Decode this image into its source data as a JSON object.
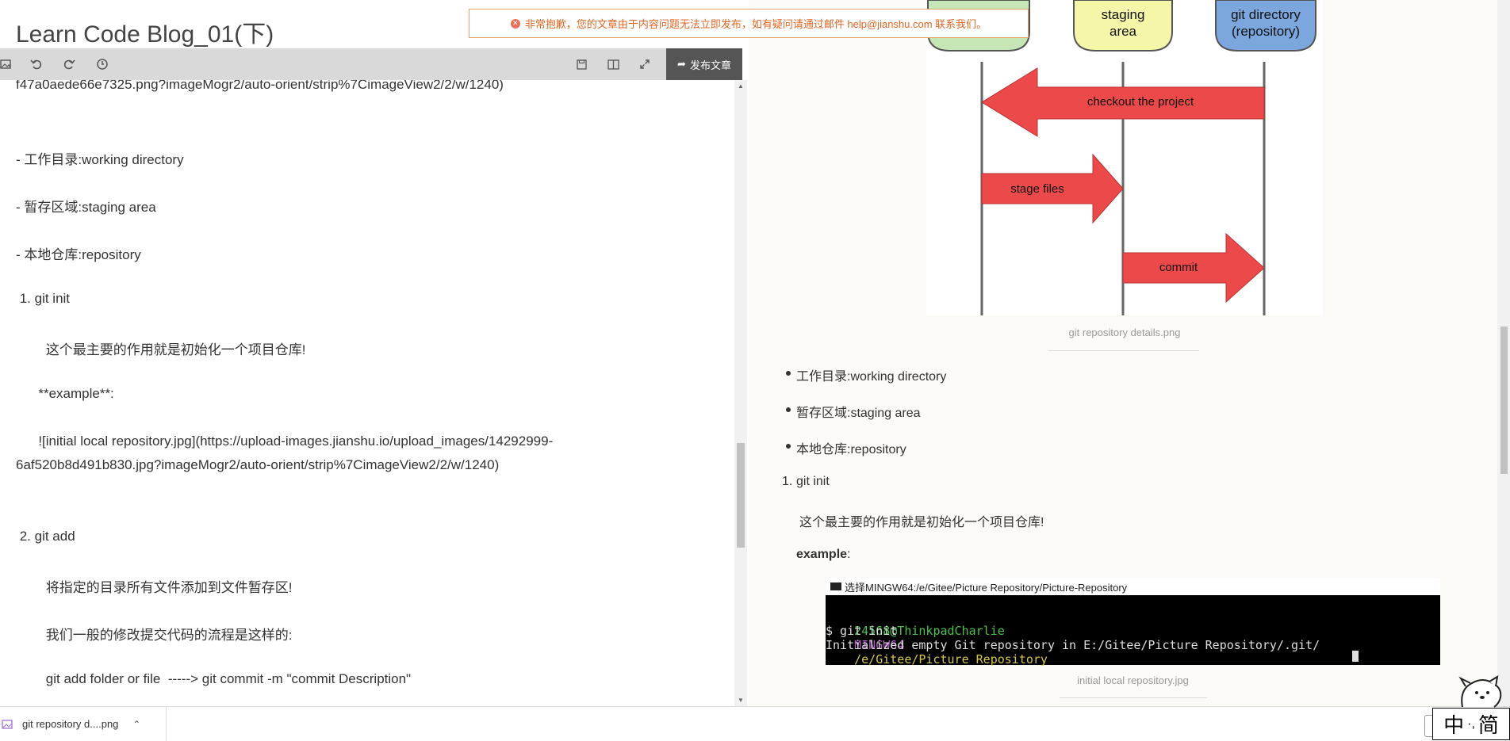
{
  "editor": {
    "title": "Learn Code Blog_01(下)",
    "publish_label": "发布文章",
    "lines": {
      "l0": "f47a0aede66e7325.png?imageMogr2/auto-orient/strip%7CimageView2/2/w/1240)",
      "l1": "- 工作目录:working directory",
      "l2": "- 暂存区域:staging area",
      "l3": "- 本地仓库:repository",
      "l4": " 1. git init",
      "l5": "        这个最主要的作用就是初始化一个项目仓库!",
      "l6": "      **example**:",
      "l7": "      ![initial local repository.jpg](https://upload-images.jianshu.io/upload_images/14292999-",
      "l8": "6af520b8d491b830.jpg?imageMogr2/auto-orient/strip%7CimageView2/2/w/1240)",
      "l9": " 2. git add",
      "l10": "        将指定的目录所有文件添加到文件暂存区!",
      "l11": "        我们一般的修改提交代码的流程是这样的:",
      "l12": "        git add folder or file  -----> git commit -m \"commit Description\""
    }
  },
  "notice": {
    "text": "非常抱歉，您的文章由于内容问题无法立即发布，如有疑问请通过邮件 help@jianshu.com 联系我们。"
  },
  "diagram": {
    "staging": "staging\narea",
    "gitdir": "git directory\n(repository)",
    "checkout": "checkout the project",
    "stage": "stage files",
    "commit": "commit",
    "caption": "git repository details.png"
  },
  "preview": {
    "b1": "工作目录:working directory",
    "b2": "暂存区域:staging area",
    "b3": "本地仓库:repository",
    "n1": "1.",
    "n1t": "git init",
    "desc": "这个最主要的作用就是初始化一个项目仓库!",
    "example": "example",
    "colon": ":",
    "caption2": "initial local repository.jpg"
  },
  "terminal": {
    "title": "选择MINGW64:/e/Gitee/Picture Repository/Picture-Repository",
    "user": "24568@ThinkpadCharlie",
    "env": "MINGW64",
    "path": "/e/Gitee/Picture Repository",
    "cmd": "$ git init",
    "out": "Initialized empty Git repository in E:/Gitee/Picture Repository/.git/"
  },
  "download": {
    "file": "git repository d....png"
  },
  "ime": {
    "left": "中",
    "sep": "·,",
    "right": "简"
  },
  "colors": {
    "arrow_red": "#ec4a4a",
    "green_box": "#c7e6b5",
    "yellow_box": "#f5f7a8",
    "blue_box": "#7ba7de"
  }
}
